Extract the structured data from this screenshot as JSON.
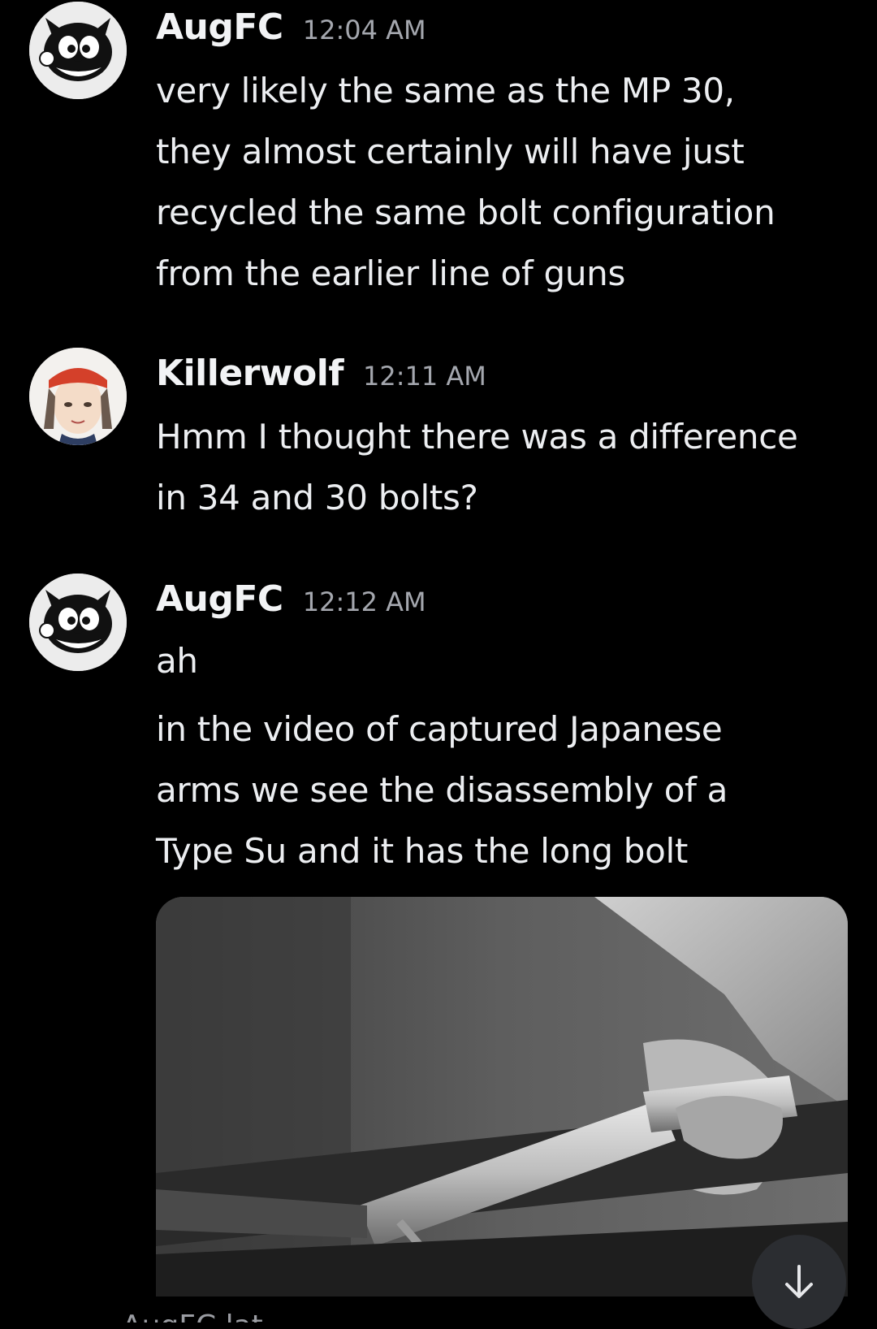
{
  "messages": [
    {
      "author": "AugFC",
      "time": "12:04 AM",
      "avatar": "cartoon-cat-icon",
      "paragraphs": [
        "very likely the same as the MP 30,\nthey almost certainly will have just\nrecycled the same bolt configuration\nfrom the earlier line of guns"
      ]
    },
    {
      "author": "Killerwolf",
      "time": "12:11 AM",
      "avatar": "anime-girl-icon",
      "paragraphs": [
        "Hmm I thought there was a difference\nin 34 and 30 bolts?"
      ]
    },
    {
      "author": "AugFC",
      "time": "12:12 AM",
      "avatar": "cartoon-cat-icon",
      "paragraphs": [
        "ah",
        "in the video of captured Japanese\narms we see the disassembly of a\nType Su and it has the long bolt"
      ],
      "attachment": "video-still-image"
    }
  ],
  "peek_text": "AugFC lat...",
  "scroll_button": "arrow-down-icon"
}
